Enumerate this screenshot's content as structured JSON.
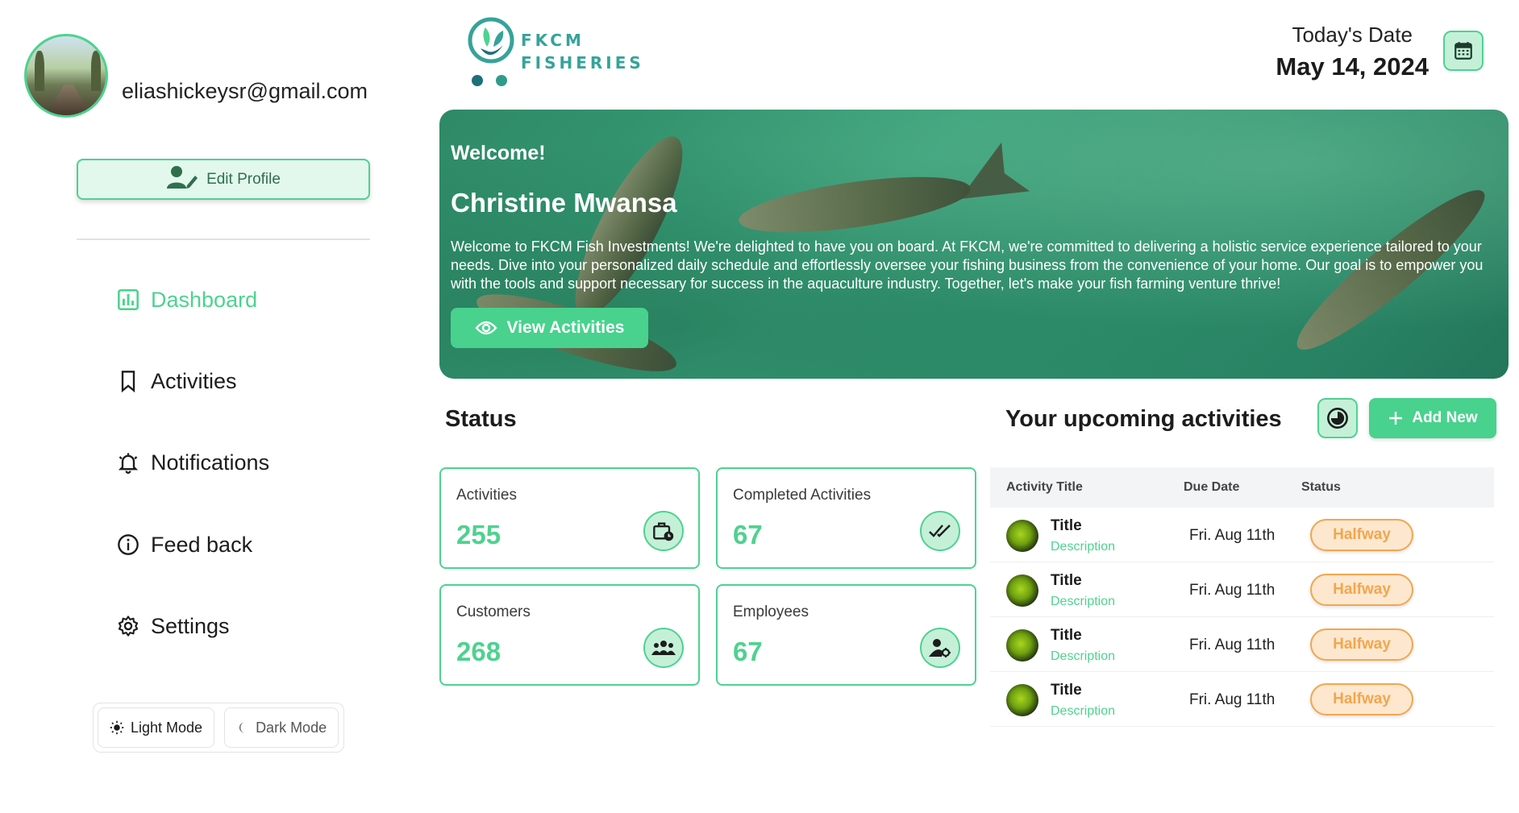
{
  "user": {
    "email": "eliashickeysr@gmail.com",
    "edit_profile_label": "Edit Profile"
  },
  "nav": [
    {
      "label": "Dashboard",
      "icon": "bar-chart-icon",
      "active": true
    },
    {
      "label": "Activities",
      "icon": "bookmark-icon",
      "active": false
    },
    {
      "label": "Notifications",
      "icon": "bell-icon",
      "active": false
    },
    {
      "label": "Feed back",
      "icon": "info-icon",
      "active": false
    },
    {
      "label": "Settings",
      "icon": "gear-icon",
      "active": false
    }
  ],
  "theme": {
    "light_label": "Light Mode",
    "dark_label": "Dark Mode"
  },
  "logo": {
    "line1": "FKCM",
    "line2": "FISHERIES"
  },
  "date": {
    "label": "Today's Date",
    "value": "May 14, 2024"
  },
  "banner": {
    "welcome": "Welcome!",
    "name": "Christine Mwansa",
    "text": "Welcome to FKCM Fish Investments! We're delighted to have you on board. At FKCM, we're committed to delivering a holistic service experience tailored to your needs. Dive into your personalized daily schedule and effortlessly oversee your fishing business from the convenience of your home. Our goal is to empower you with the tools and support necessary for success in the aquaculture industry. Together, let's make your fish farming venture thrive!",
    "button_label": "View Activities"
  },
  "status": {
    "title": "Status",
    "cards": [
      {
        "label": "Activities",
        "value": "255",
        "icon": "briefcase-clock-icon"
      },
      {
        "label": "Completed Activities",
        "value": "67",
        "icon": "double-check-icon"
      },
      {
        "label": "Customers",
        "value": "268",
        "icon": "group-icon"
      },
      {
        "label": "Employees",
        "value": "67",
        "icon": "user-gear-icon"
      }
    ]
  },
  "upcoming": {
    "title": "Your upcoming activities",
    "add_label": "Add New",
    "columns": [
      "Activity Title",
      "Due Date",
      "Status"
    ],
    "rows": [
      {
        "title": "Title",
        "description": "Description",
        "due": "Fri. Aug 11th",
        "status": "Halfway"
      },
      {
        "title": "Title",
        "description": "Description",
        "due": "Fri. Aug 11th",
        "status": "Halfway"
      },
      {
        "title": "Title",
        "description": "Description",
        "due": "Fri. Aug 11th",
        "status": "Halfway"
      },
      {
        "title": "Title",
        "description": "Description",
        "due": "Fri. Aug 11th",
        "status": "Halfway"
      }
    ]
  },
  "colors": {
    "accent": "#4ed28f",
    "accent_light": "#c4f0d8",
    "badge": "#f3a64d",
    "logo": "#36a39a"
  }
}
